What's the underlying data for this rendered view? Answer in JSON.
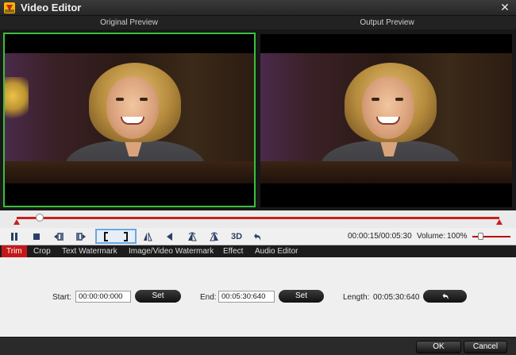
{
  "window": {
    "title": "Video Editor",
    "close_glyph": "✕"
  },
  "previews": {
    "original_label": "Original Preview",
    "output_label": "Output Preview"
  },
  "timeline": {
    "progress": 0.048
  },
  "controls": {
    "buttons": [
      "pause-icon",
      "stop-icon",
      "prev-frame-icon",
      "next-frame-icon",
      "trim-start-icon",
      "trim-end-icon",
      "flip-vertical-icon",
      "rotate-left-icon",
      "flip-horizontal-icon",
      "rotate-right-icon",
      "3d-icon",
      "undo-icon"
    ],
    "threed_label": "3D",
    "time": "00:00:15/00:05:30",
    "volume_label": "Volume:",
    "volume_value": "100%",
    "volume_level": 0.2
  },
  "tabs": [
    {
      "label": "Trim",
      "active": true
    },
    {
      "label": "Crop",
      "active": false
    },
    {
      "label": "Text Watermark",
      "active": false
    },
    {
      "label": "Image/Video Watermark",
      "active": false
    },
    {
      "label": "Effect",
      "active": false
    },
    {
      "label": "Audio Editor",
      "active": false
    }
  ],
  "trim": {
    "start_label": "Start:",
    "start_value": "00:00:00:000",
    "set_label": "Set",
    "end_label": "End:",
    "end_value": "00:05:30:640",
    "length_label": "Length:",
    "length_value": "00:05:30:640"
  },
  "footer": {
    "ok_label": "OK",
    "cancel_label": "Cancel"
  },
  "colors": {
    "accent": "#c41818",
    "preview_border": "#3bbf3b"
  }
}
